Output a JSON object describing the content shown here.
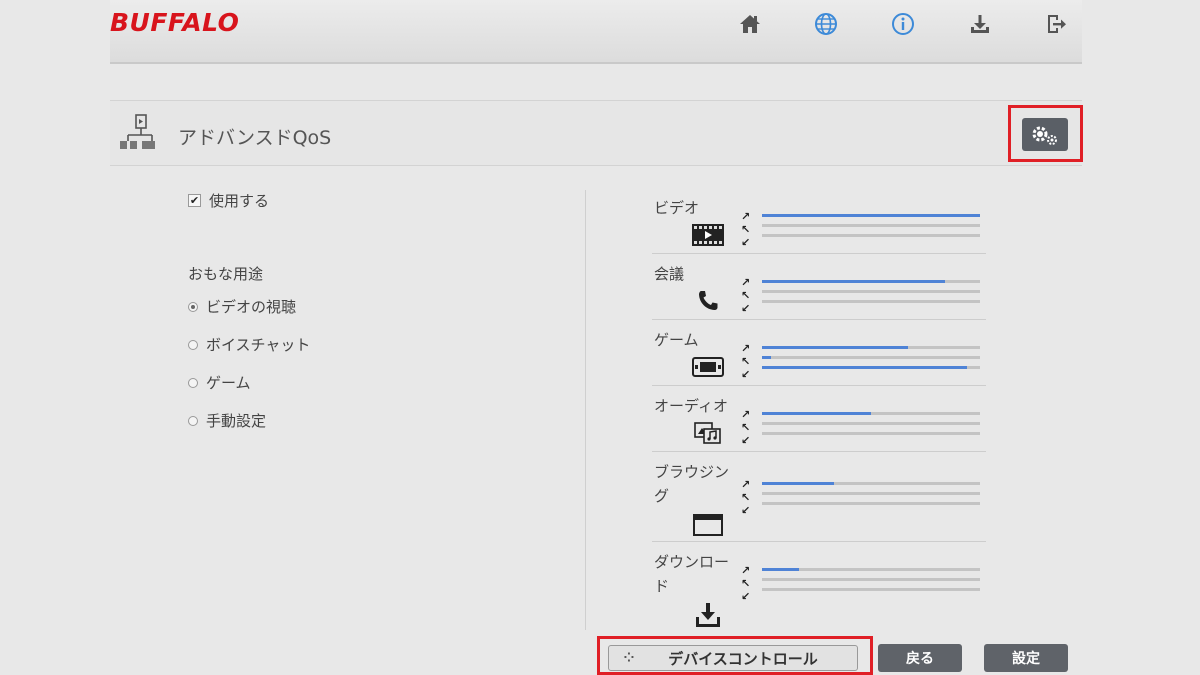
{
  "header": {
    "logo": "BUFFALO",
    "icons": [
      "home-icon",
      "globe-icon",
      "info-icon",
      "download-icon",
      "logout-icon"
    ],
    "brand_color": "#d8141c",
    "accent_color": "#4f83d6"
  },
  "section": {
    "title": "アドバンスドQoS",
    "settings_icon": "gears-icon"
  },
  "left": {
    "enable_label": "使用する",
    "enable_checked": true,
    "purpose_label": "おもな用途",
    "options": [
      {
        "label": "ビデオの視聴",
        "selected": true
      },
      {
        "label": "ボイスチャット",
        "selected": false
      },
      {
        "label": "ゲーム",
        "selected": false
      },
      {
        "label": "手動設定",
        "selected": false
      }
    ]
  },
  "categories": [
    {
      "name": "ビデオ",
      "icon": "film-icon",
      "bars": [
        1.0,
        0.0,
        0.0
      ]
    },
    {
      "name": "会議",
      "icon": "phone-icon",
      "bars": [
        0.84,
        0.0,
        0.0
      ]
    },
    {
      "name": "ゲーム",
      "icon": "game-console-icon",
      "bars": [
        0.67,
        0.04,
        0.94
      ]
    },
    {
      "name": "オーディオ",
      "icon": "audio-icon",
      "bars": [
        0.5,
        0.0,
        0.0
      ]
    },
    {
      "name": "ブラウジング",
      "icon": "browser-window-icon",
      "bars": [
        0.33,
        0.0,
        0.0
      ]
    },
    {
      "name": "ダウンロード",
      "icon": "download-tray-icon",
      "bars": [
        0.17,
        0.0,
        0.0
      ]
    }
  ],
  "buttons": {
    "device_control": "デバイスコントロール",
    "back": "戻る",
    "settings": "設定"
  }
}
